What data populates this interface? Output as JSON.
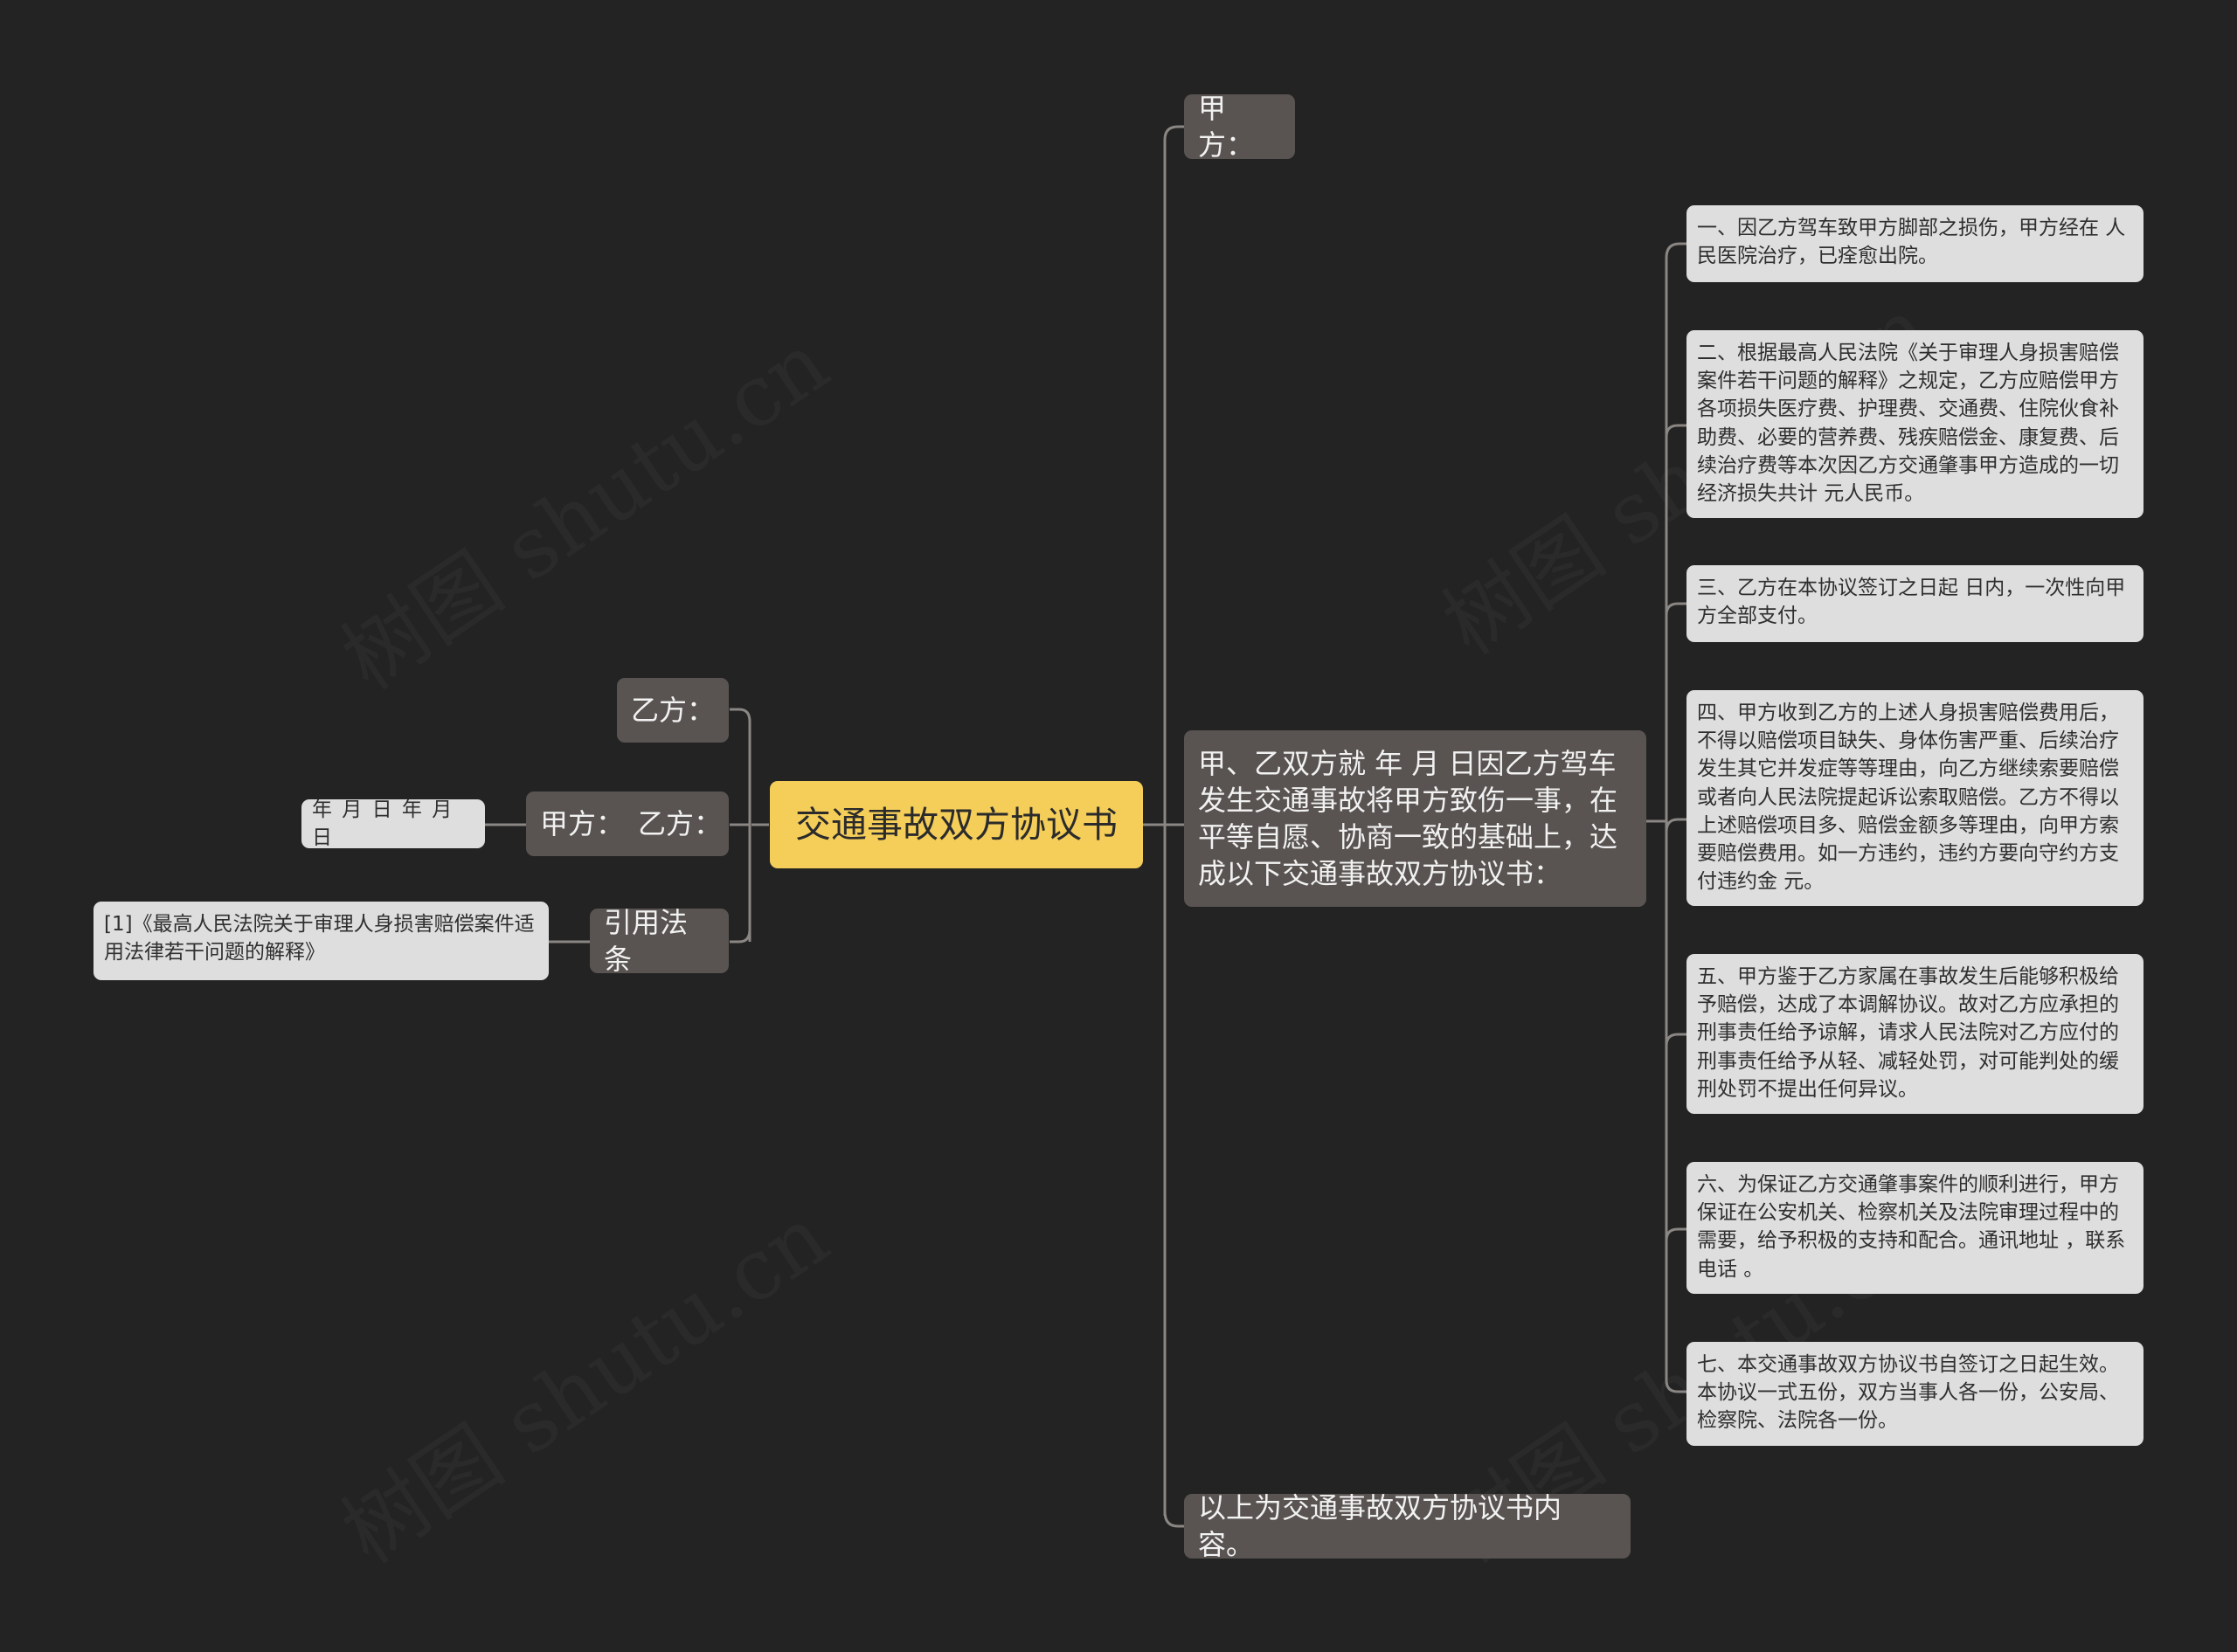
{
  "root": {
    "label": "交通事故双方协议书"
  },
  "left_branches": [
    {
      "label": "乙方："
    },
    {
      "label": "甲方：　乙方：",
      "child": "年 月 日 年 月 日"
    },
    {
      "label": "引用法条",
      "child": "[1]《最高人民法院关于审理人身损害赔偿案件适用法律若干问题的解释》"
    }
  ],
  "right_branches": [
    {
      "label": "甲方："
    },
    {
      "label": "甲、乙双方就 年 月 日因乙方驾车发生交通事故将甲方致伤一事，在平等自愿、协商一致的基础上，达成以下交通事故双方协议书："
    },
    {
      "label": "以上为交通事故双方协议书内容。"
    }
  ],
  "clauses": [
    "一、因乙方驾车致甲方脚部之损伤，甲方经在 人民医院治疗，已痊愈出院。",
    "二、根据最高人民法院《关于审理人身损害赔偿案件若干问题的解释》之规定，乙方应赔偿甲方各项损失医疗费、护理费、交通费、住院伙食补助费、必要的营养费、残疾赔偿金、康复费、后续治疗费等本次因乙方交通肇事甲方造成的一切经济损失共计 元人民币。",
    "三、乙方在本协议签订之日起 日内，一次性向甲方全部支付。",
    "四、甲方收到乙方的上述人身损害赔偿费用后，不得以赔偿项目缺失、身体伤害严重、后续治疗发生其它并发症等等理由，向乙方继续索要赔偿或者向人民法院提起诉讼索取赔偿。乙方不得以上述赔偿项目多、赔偿金额多等理由，向甲方索要赔偿费用。如一方违约，违约方要向守约方支付违约金 元。",
    "五、甲方鉴于乙方家属在事故发生后能够积极给予赔偿，达成了本调解协议。故对乙方应承担的刑事责任给予谅解，请求人民法院对乙方应付的刑事责任给予从轻、减轻处罚，对可能判处的缓刑处罚不提出任何异议。",
    "六、为保证乙方交通肇事案件的顺利进行，甲方保证在公安机关、检察机关及法院审理过程中的需要，给予积极的支持和配合。通讯地址 ，联系电话 。",
    "七、本交通事故双方协议书自签订之日起生效。本协议一式五份，双方当事人各一份，公安局、检察院、法院各一份。"
  ],
  "colors": {
    "background": "#232323",
    "root": "#f5ce5a",
    "branch": "#595452",
    "leaf": "#dedede",
    "connector": "#8a8683"
  }
}
